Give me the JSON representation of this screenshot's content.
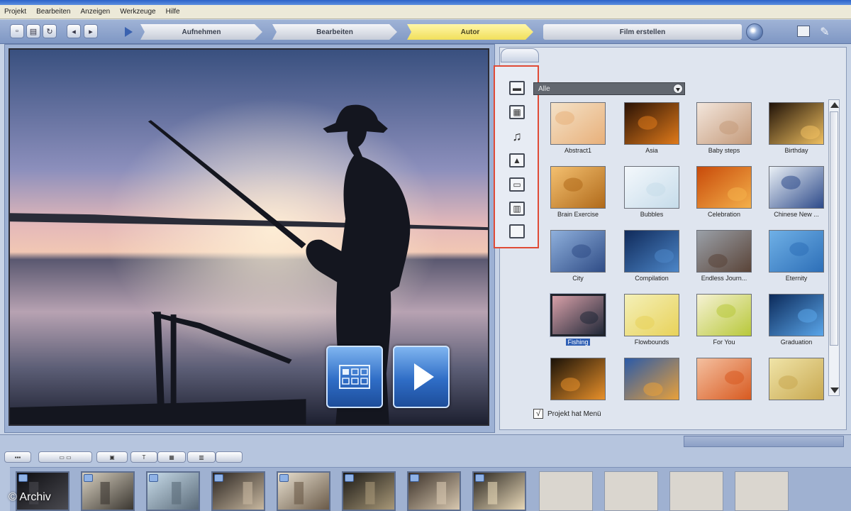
{
  "menu": [
    "Projekt",
    "Bearbeiten",
    "Anzeigen",
    "Werkzeuge",
    "Hilfe"
  ],
  "workflow": {
    "steps": [
      {
        "label": "Aufnehmen",
        "active": false
      },
      {
        "label": "Bearbeiten",
        "active": false
      },
      {
        "label": "Autor",
        "active": true
      },
      {
        "label": "Film erstellen",
        "active": false
      }
    ]
  },
  "library": {
    "category_dropdown": "Alle",
    "side_tools": [
      "video-icon",
      "film-icon",
      "music-icon",
      "photo-icon",
      "title-icon",
      "menu-template-icon",
      "blank-frame-icon"
    ],
    "themes": [
      {
        "label": "Abstract1",
        "colors": [
          "#f4e2c8",
          "#e8b07a"
        ]
      },
      {
        "label": "Asia",
        "colors": [
          "#2a1205",
          "#e07a1a"
        ]
      },
      {
        "label": "Baby steps",
        "colors": [
          "#f3e6dc",
          "#c49a7a"
        ]
      },
      {
        "label": "Birthday",
        "colors": [
          "#201208",
          "#f0c060"
        ]
      },
      {
        "label": "Brain Exercise",
        "colors": [
          "#f4c070",
          "#b06a1a"
        ]
      },
      {
        "label": "Bubbles",
        "colors": [
          "#f4f8fc",
          "#c6dcea"
        ]
      },
      {
        "label": "Celebration",
        "colors": [
          "#c84a0a",
          "#f4b04a"
        ]
      },
      {
        "label": "Chinese New ...",
        "colors": [
          "#eaf0f6",
          "#2d4a8a"
        ]
      },
      {
        "label": "City",
        "colors": [
          "#8fb0dc",
          "#2f4c86"
        ]
      },
      {
        "label": "Compilation",
        "colors": [
          "#102a5a",
          "#4c86c8"
        ]
      },
      {
        "label": "Endless Journ...",
        "colors": [
          "#9aa0a8",
          "#5a4438"
        ]
      },
      {
        "label": "Eternity",
        "colors": [
          "#6fb0e6",
          "#2d6fb8"
        ]
      },
      {
        "label": "Fishing",
        "colors": [
          "#d8a0a8",
          "#202838"
        ],
        "selected": true
      },
      {
        "label": "Flowbounds",
        "colors": [
          "#f4f0b8",
          "#e8d25a"
        ]
      },
      {
        "label": "For You",
        "colors": [
          "#f6f2d4",
          "#b8c83a"
        ]
      },
      {
        "label": "Graduation",
        "colors": [
          "#0c2a5a",
          "#5aa6ea"
        ]
      },
      {
        "label": "",
        "colors": [
          "#1a1208",
          "#e8902a"
        ]
      },
      {
        "label": "",
        "colors": [
          "#2a5aa8",
          "#e8a03a"
        ]
      },
      {
        "label": "",
        "colors": [
          "#f4c0a0",
          "#d85a20"
        ]
      },
      {
        "label": "",
        "colors": [
          "#f0e4a8",
          "#c8a850"
        ]
      }
    ],
    "menu_checkbox": {
      "label": "Projekt hat Menü",
      "checked": "√"
    }
  },
  "watermark": "© Archiv"
}
